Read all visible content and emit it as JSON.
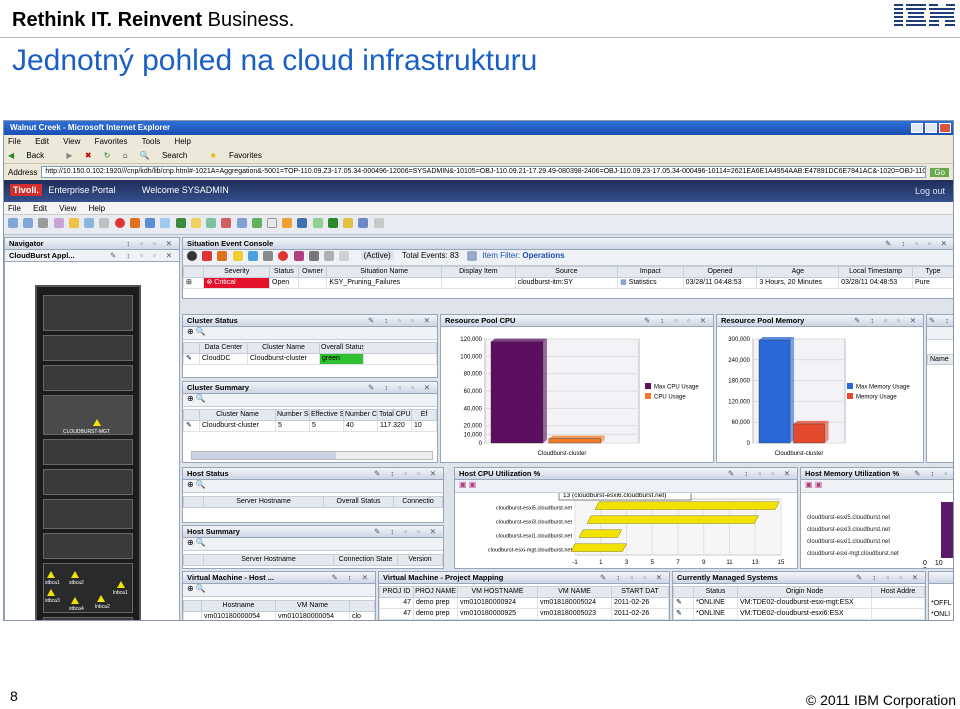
{
  "slide": {
    "brand_bold1": "Rethink IT.",
    "brand_bold2": "Reinvent",
    "brand_rest": "Business.",
    "logo": "IBM",
    "title": "Jednotný pohled na cloud infrastrukturu",
    "page_number": "8",
    "copyright": "© 2011 IBM Corporation"
  },
  "browser": {
    "title": "Walnut Creek - Microsoft Internet Explorer",
    "menu": [
      "File",
      "Edit",
      "View",
      "Favorites",
      "Tools",
      "Help"
    ],
    "toolbar": [
      "Back",
      "Search",
      "Favorites"
    ],
    "address_label": "Address",
    "address": "http://10.150.0.102:1920///cnp/kdh/lib/cnp.html#-1021A=Aggregation&-5001=TOP-110.09.Z3-17.05.34-000496-12006=SYSADMIN&-10105=OBJ-110.09.21-17.29.49-080398-2406=OBJ-110.09.23-17.05.34-000496-10114=2621EA6E1A4954AAB:E47891DC6E7841AC&-1020=OBJ-110.09.2",
    "go": "Go"
  },
  "portal": {
    "tivoli": "Tivoli.",
    "name": "Enterprise Portal",
    "welcome": "Welcome SYSADMIN",
    "logout": "Log out",
    "menu": [
      "File",
      "Edit",
      "View",
      "Help"
    ]
  },
  "navigator": {
    "title": "Navigator",
    "subtitle": "CloudBurst Appl..."
  },
  "rack": {
    "labels": [
      "CLOUDBURST-MGT",
      "stbca1",
      "stbca2",
      "stbca3",
      "stbca4",
      "lnbca1",
      "lnbca2"
    ]
  },
  "events": {
    "title": "Situation Event Console",
    "active_label": "(Active)",
    "total_label": "Total Events:",
    "total": "83",
    "filter_label": "Item Filter:",
    "filter": "Operations",
    "columns": [
      "Severity",
      "Status",
      "Owner",
      "Situation Name",
      "Display Item",
      "Source",
      "Impact",
      "Opened",
      "Age",
      "Local Timestamp",
      "Type"
    ],
    "row": [
      "Critical",
      "Open",
      "",
      "KSY_Pruning_Failures",
      "",
      "cloudburst-itm:SY",
      "Statistics",
      "03/28/11 04:48:53",
      "3 Hours, 20 Minutes",
      "03/28/11 04:48:53",
      "Pure"
    ]
  },
  "cluster_status": {
    "title": "Cluster Status",
    "columns": [
      "Data Center",
      "Cluster Name",
      "Overall Status"
    ],
    "row": [
      "CloudDC",
      "Cloudburst-cluster",
      "green"
    ]
  },
  "cluster_summary": {
    "title": "Cluster Summary",
    "columns": [
      "Cluster Name",
      "Number Servers",
      "Effective Servers",
      "Number CPUs",
      "Total CPU",
      "Ef"
    ],
    "row": [
      "Cloudburst-cluster",
      "5",
      "5",
      "40",
      "117.320",
      "10"
    ]
  },
  "host_status": {
    "title": "Host Status",
    "columns": [
      "Server Hostname",
      "Overall Status",
      "Connectio"
    ]
  },
  "host_summary": {
    "title": "Host Summary",
    "columns": [
      "Server Hostname",
      "Connection State",
      "Version"
    ]
  },
  "host_memory_util": {
    "title": "Host Memory Utilization %",
    "hosts": [
      "cloudburst-esxi5.cloudburst.net",
      "cloudburst-esxi3.cloudburst.net",
      "cloudburst-esxi1.cloudburst.net",
      "cloudburst-esxi-mgt.cloudburst.net"
    ],
    "ticks": [
      "0",
      "10",
      "2"
    ]
  },
  "vm_host": {
    "title": "Virtual Machine - Host ...",
    "columns": [
      "Hostname",
      "VM Name"
    ],
    "row": [
      "vm010180000054",
      "vm010180000054",
      "clo"
    ]
  },
  "vm_project": {
    "title": "Virtual Machine - Project Mapping",
    "columns": [
      "PROJ ID",
      "PROJ NAME",
      "VM HOSTNAME",
      "VM NAME",
      "START DAT"
    ],
    "rows": [
      [
        "47",
        "demo prep",
        "vm010180000924",
        "vm018180005024",
        "2011-02-26"
      ],
      [
        "47",
        "demo prep",
        "vm010180000925",
        "vm018180005023",
        "2011-02-26"
      ]
    ]
  },
  "managed_systems": {
    "title": "Currently Managed Systems",
    "columns": [
      "Status",
      "Origin Node",
      "Host Addre"
    ],
    "rows": [
      [
        "*ONLINE",
        "VM:TDE02-cloudburst-esxi-mgt:ESX",
        ""
      ],
      [
        "*ONLINE",
        "VM:TDE02-cloudburst-esxi6:ESX",
        ""
      ]
    ],
    "right_col": [
      "*OFFL",
      "*ONLI"
    ]
  },
  "right_panel": {
    "column": "Name"
  },
  "chart_data": [
    {
      "type": "bar",
      "title": "Resource Pool CPU",
      "categories": [
        "Cloudburst-cluster"
      ],
      "series": [
        {
          "name": "Max CPU Usage",
          "values": [
            117000
          ],
          "color": "#5b0f5e"
        },
        {
          "name": "CPU Usage",
          "values": [
            5000
          ],
          "color": "#f07a2a"
        }
      ],
      "yticks": [
        "0",
        "10,000",
        "20,000",
        "40,000",
        "60,000",
        "80,000",
        "100,000",
        "120,000"
      ],
      "ylim": [
        0,
        120000
      ]
    },
    {
      "type": "bar",
      "title": "Resource Pool Memory",
      "categories": [
        "Cloudburst-cluster"
      ],
      "series": [
        {
          "name": "Max Memory Usage",
          "values": [
            297000
          ],
          "color": "#2a68d8"
        },
        {
          "name": "Memory Usage",
          "values": [
            55000
          ],
          "color": "#e44a2e"
        }
      ],
      "yticks": [
        "0",
        "60,000",
        "120,000",
        "180,000",
        "240,000",
        "300,000"
      ],
      "ylim": [
        0,
        300000
      ]
    },
    {
      "type": "bar",
      "title": "Host CPU Utilization %",
      "tooltip": "13 (cloudburst-esxi6.cloudburst.net)",
      "categories": [
        "cloudburst-esxi5.cloudburst.net",
        "cloudburst-esxi3.cloudburst.net",
        "cloudburst-esxi1.cloudburst.net",
        "cloudburst-esxi-mgt.cloudburst.net"
      ],
      "values": [
        13,
        12,
        2,
        3
      ],
      "xticks": [
        "-1",
        "1",
        "3",
        "5",
        "7",
        "9",
        "11",
        "13",
        "15"
      ],
      "xlim": [
        -1,
        15
      ]
    }
  ]
}
